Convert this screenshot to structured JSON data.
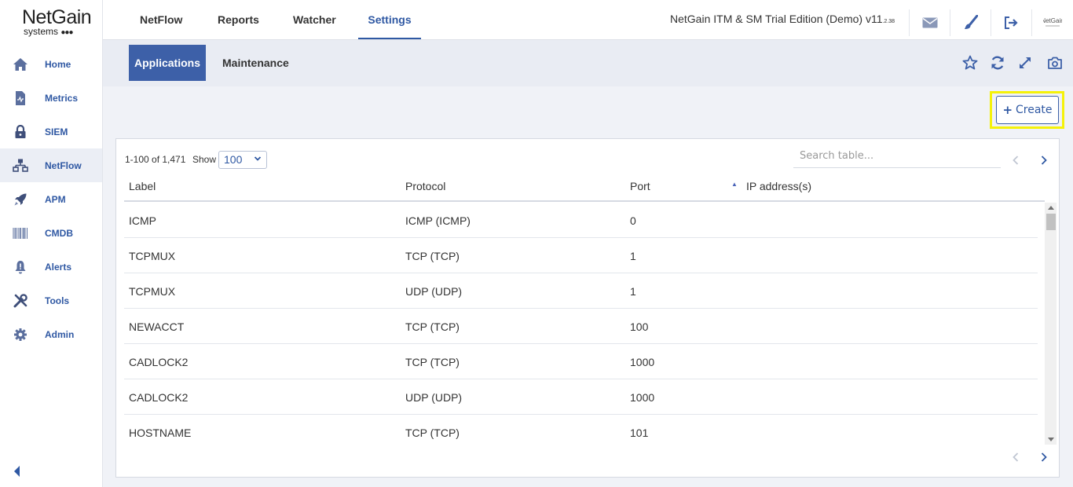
{
  "logo": {
    "name": "NetGain",
    "sub": "systems",
    "dots": "●●●"
  },
  "sidebar": {
    "items": [
      {
        "label": "Home",
        "icon": "home-icon"
      },
      {
        "label": "Metrics",
        "icon": "metrics-icon"
      },
      {
        "label": "SIEM",
        "icon": "lock-icon"
      },
      {
        "label": "NetFlow",
        "icon": "network-icon",
        "active": true
      },
      {
        "label": "APM",
        "icon": "rocket-icon"
      },
      {
        "label": "CMDB",
        "icon": "barcode-icon"
      },
      {
        "label": "Alerts",
        "icon": "bell-icon"
      },
      {
        "label": "Tools",
        "icon": "tools-icon"
      },
      {
        "label": "Admin",
        "icon": "gear-icon"
      }
    ]
  },
  "topnav": {
    "tabs": [
      {
        "label": "NetFlow"
      },
      {
        "label": "Reports"
      },
      {
        "label": "Watcher"
      },
      {
        "label": "Settings",
        "active": true
      }
    ],
    "edition": "NetGain ITM & SM Trial Edition (Demo) v11",
    "version_suffix": ".2.38"
  },
  "subnav": {
    "tabs": [
      {
        "label": "Applications",
        "active": true
      },
      {
        "label": "Maintenance"
      }
    ]
  },
  "create_button": {
    "label": "Create"
  },
  "table": {
    "range_text": "1-100 of 1,471",
    "show_label": "Show",
    "page_size": "100",
    "search_placeholder": "Search table...",
    "columns": [
      "Label",
      "Protocol",
      "Port",
      "IP address(s)"
    ],
    "sorted_column": "IP address(s)",
    "rows": [
      [
        "ICMP",
        "ICMP (ICMP)",
        "0",
        ""
      ],
      [
        "TCPMUX",
        "TCP (TCP)",
        "1",
        ""
      ],
      [
        "TCPMUX",
        "UDP (UDP)",
        "1",
        ""
      ],
      [
        "NEWACCT",
        "TCP (TCP)",
        "100",
        ""
      ],
      [
        "CADLOCK2",
        "TCP (TCP)",
        "1000",
        ""
      ],
      [
        "CADLOCK2",
        "UDP (UDP)",
        "1000",
        ""
      ],
      [
        "HOSTNAME",
        "TCP (TCP)",
        "101",
        ""
      ]
    ]
  },
  "colors": {
    "accent": "#3d60a8",
    "highlight": "#f5f20a"
  }
}
